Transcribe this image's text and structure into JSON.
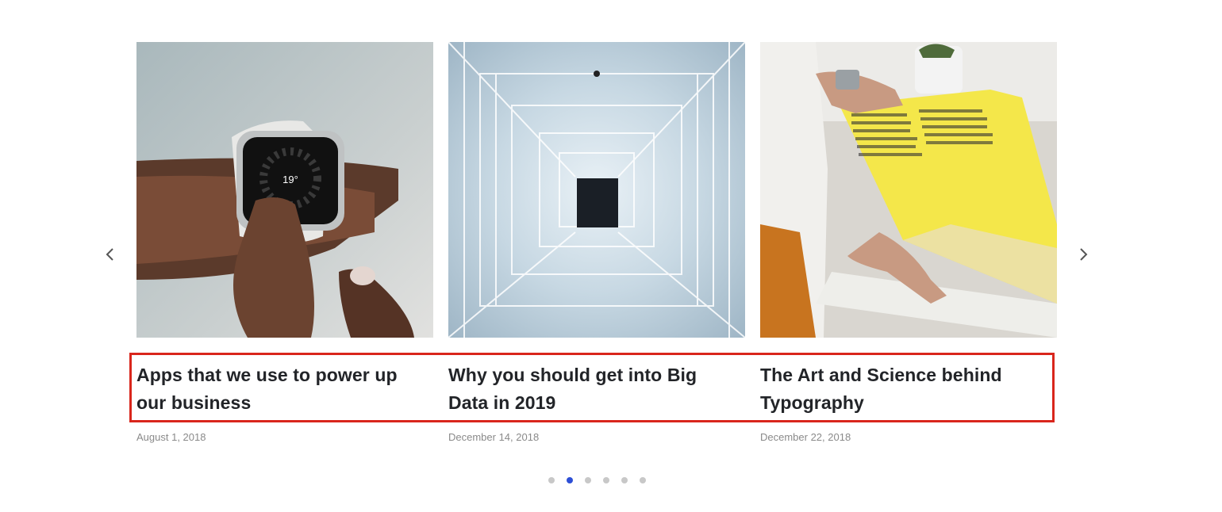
{
  "carousel": {
    "prev_icon": "chevron-left-icon",
    "next_icon": "chevron-right-icon",
    "posts": [
      {
        "title": "Apps that we use to power up our business",
        "date": "August 1, 2018",
        "image": "smartwatch-on-wrist-photo"
      },
      {
        "title": "Why you should get into Big Data in 2019",
        "date": "December 14, 2018",
        "image": "light-corridor-photo"
      },
      {
        "title": "The Art and Science behind Typography",
        "date": "December 22, 2018",
        "image": "yellow-magazine-photo"
      }
    ],
    "pagination": {
      "count": 6,
      "active_index": 1
    },
    "colors": {
      "active_dot": "#2d4fd6",
      "inactive_dot": "#c8c8c8",
      "highlight_border": "#d9261c"
    }
  }
}
